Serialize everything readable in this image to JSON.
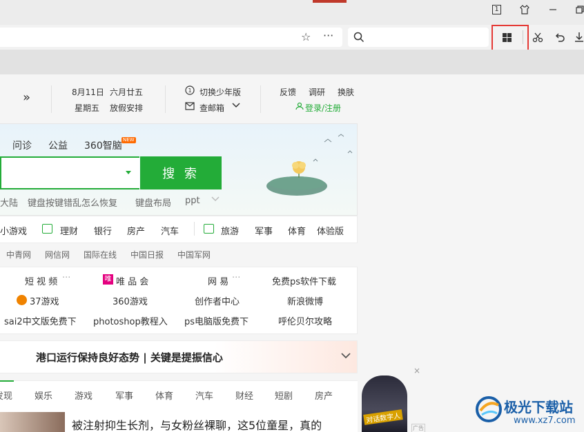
{
  "window": {
    "tab_count_badge": "1"
  },
  "top_info": {
    "date": "8月11日",
    "lunar": "六月廿五",
    "weekday": "星期五",
    "holiday": "放假安排",
    "youth_mode": "切换少年版",
    "mail": "查邮箱",
    "feedback": "反馈",
    "survey": "调研",
    "skin": "换肤",
    "login": "登录/注册"
  },
  "search": {
    "tabs": [
      "问诊",
      "公益",
      "360智脑"
    ],
    "new_badge": "NEW",
    "button_label": "搜 索",
    "hot_words": [
      "大陆",
      "键盘按键错乱怎么恢复",
      "键盘布局",
      "ppt"
    ]
  },
  "categories": [
    "小游戏",
    "理财",
    "银行",
    "房产",
    "汽车",
    "旅游",
    "军事",
    "体育",
    "体验版"
  ],
  "media": [
    "中青网",
    "网信网",
    "国际在线",
    "中国日报",
    "中国军网"
  ],
  "links": {
    "row1": [
      "短 视 频",
      "唯 品 会",
      "网 易",
      "免费ps软件下载"
    ],
    "row2": [
      "37游戏",
      "360游戏",
      "创作者中心",
      "新浪微博"
    ],
    "row3": [
      "sai2中文版免费下",
      "photoshop教程入",
      "ps电脑版免费下",
      "呼伦贝尔攻略"
    ]
  },
  "news": {
    "headline": "港口运行保持良好态势 | 关键是提振信心",
    "tabs": [
      "发现",
      "娱乐",
      "游戏",
      "军事",
      "体育",
      "汽车",
      "财经",
      "短剧",
      "房产"
    ],
    "first_item": "被注射抑生长剂，与女粉丝裸聊，这5位童星，真的"
  },
  "ad": {
    "label": "对话数字人",
    "tag": "广告"
  },
  "watermark": {
    "name": "极光下载站",
    "url": "www.xz7.com"
  }
}
